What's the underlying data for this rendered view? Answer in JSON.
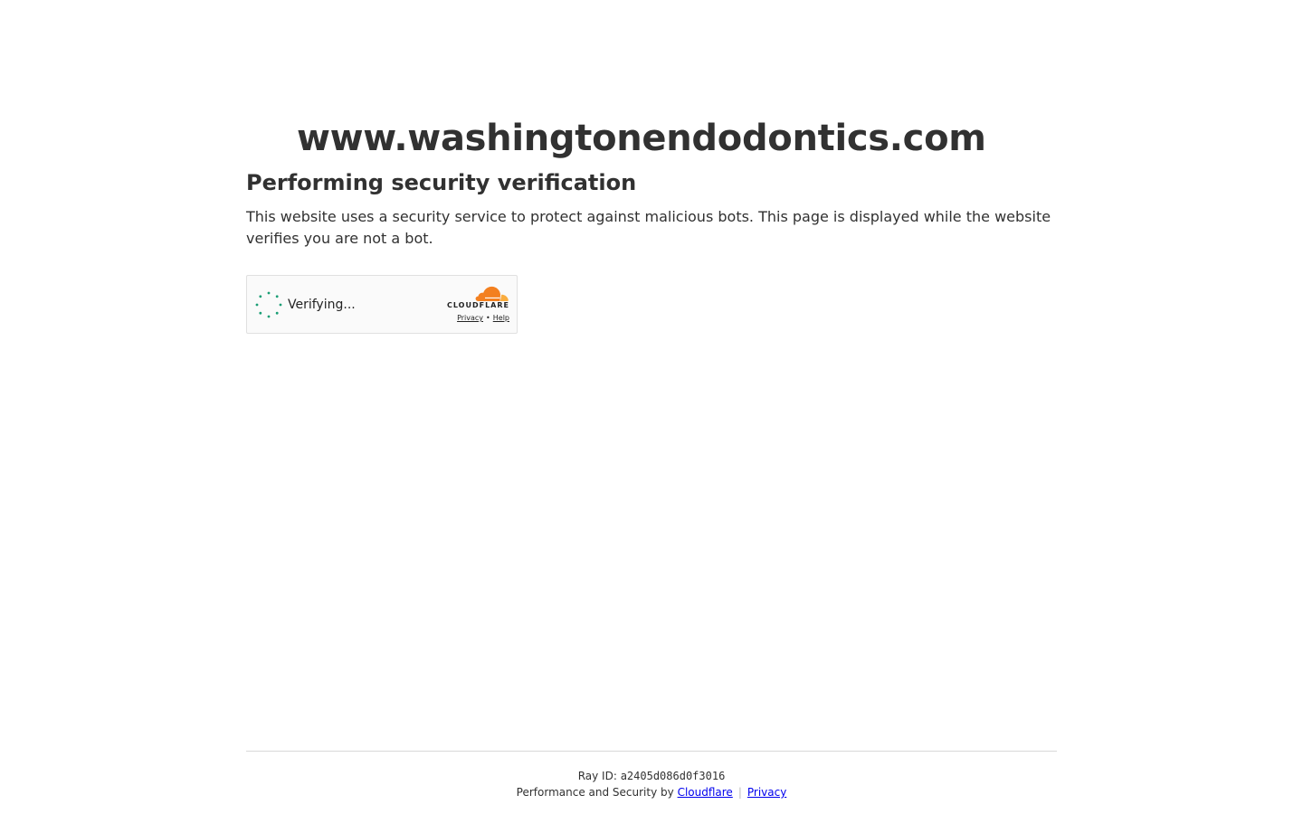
{
  "site": {
    "domain": "www.washingtonendodontics.com"
  },
  "main": {
    "heading": "Performing security verification",
    "description": "This website uses a security service to protect against malicious bots. This page is displayed while the website verifies you are not a bot."
  },
  "widget": {
    "status": "Verifying...",
    "brand": "CLOUDFLARE",
    "privacy_label": "Privacy",
    "link_separator": "•",
    "help_label": "Help",
    "spinner_color": "#1a9e75",
    "brand_orange": "#f38020",
    "brand_orange_light": "#faad3f"
  },
  "footer": {
    "ray_label": "Ray ID:",
    "ray_id": "a2405d086d0f3016",
    "perf_text": "Performance and Security by",
    "cloudflare_link": "Cloudflare",
    "divider": "|",
    "privacy_link": "Privacy"
  }
}
